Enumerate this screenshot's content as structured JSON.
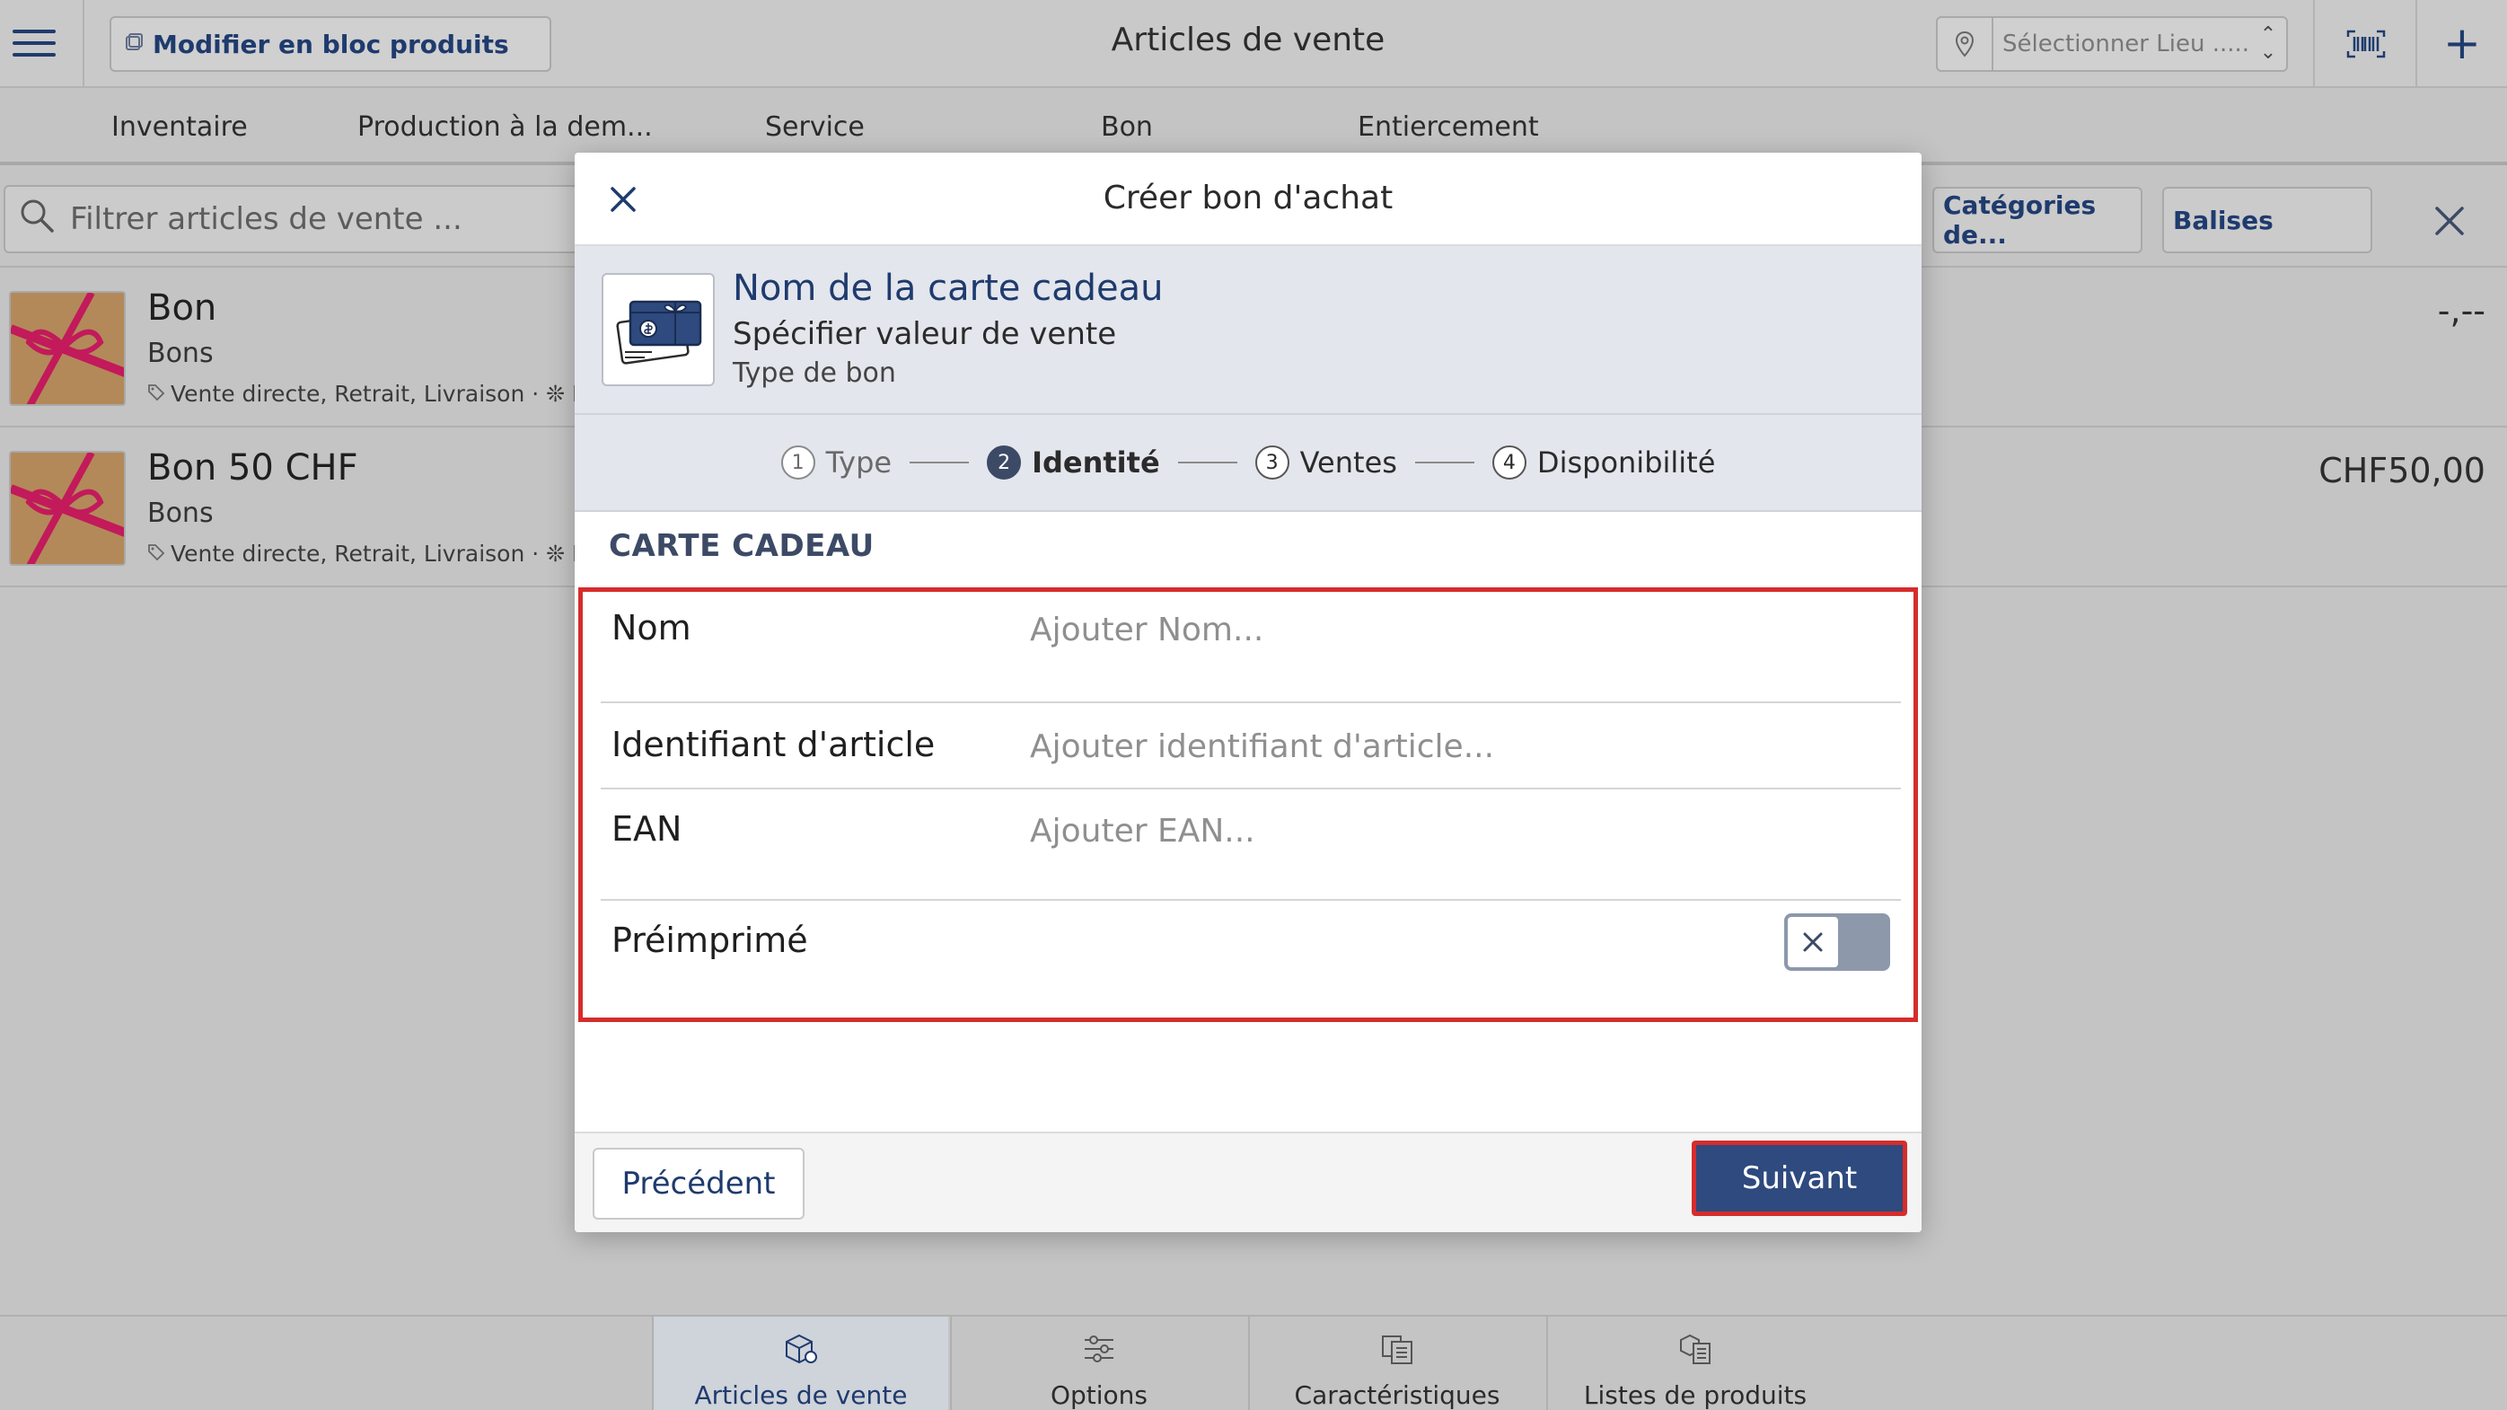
{
  "header": {
    "bulk_edit_label": "Modifier en bloc produits",
    "title": "Articles de vente",
    "location_placeholder": "Sélectionner Lieu ....."
  },
  "tabs": [
    "Inventaire",
    "Production à la dem...",
    "Service",
    "Bon",
    "Entiercement"
  ],
  "filter": {
    "placeholder": "Filtrer articles de vente ...",
    "categories_label": "Catégories de...",
    "tags_label": "Balises"
  },
  "items": [
    {
      "name": "Bon",
      "category": "Bons",
      "meta": "Vente directe, Retrait, Livraison · ❊ Re",
      "price": "-,--"
    },
    {
      "name": "Bon 50 CHF",
      "category": "Bons",
      "meta": "Vente directe, Retrait, Livraison · ❊ Re",
      "price": "CHF50,00"
    }
  ],
  "bottom_nav": [
    "Articles de vente",
    "Options",
    "Caractéristiques",
    "Listes de produits"
  ],
  "modal": {
    "title": "Créer bon d'achat",
    "summary": {
      "title": "Nom de la carte cadeau",
      "line2": "Spécifier valeur de vente",
      "line3": "Type de bon"
    },
    "steps": [
      {
        "num": "1",
        "label": "Type"
      },
      {
        "num": "2",
        "label": "Identité"
      },
      {
        "num": "3",
        "label": "Ventes"
      },
      {
        "num": "4",
        "label": "Disponibilité"
      }
    ],
    "section_title": "CARTE CADEAU",
    "fields": {
      "name_label": "Nom",
      "name_placeholder": "Ajouter Nom...",
      "id_label": "Identifiant d'article",
      "id_placeholder": "Ajouter identifiant d'article...",
      "ean_label": "EAN",
      "ean_placeholder": "Ajouter EAN...",
      "preprinted_label": "Préimprimé"
    },
    "prev_label": "Précédent",
    "next_label": "Suivant"
  },
  "colors": {
    "accent": "#2e4a7e",
    "highlight": "#d62c2c"
  }
}
